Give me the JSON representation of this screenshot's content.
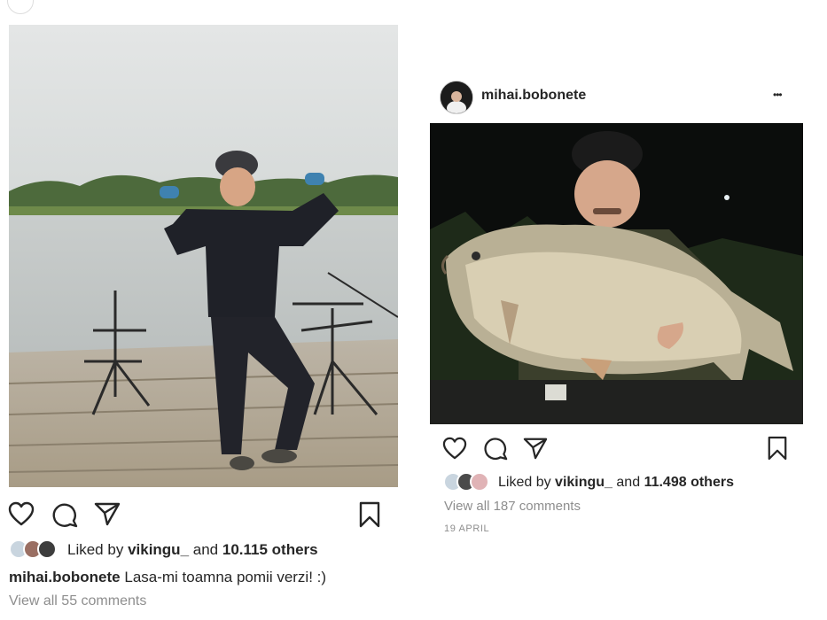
{
  "colors": {
    "text": "#262626",
    "muted": "#8e8e8e",
    "background": "#ffffff"
  },
  "post_left": {
    "likes": {
      "prefix": "Liked by",
      "user": "vikingu_",
      "middle": "and",
      "count": "10.115 others"
    },
    "caption": {
      "username": "mihai.bobonete",
      "text": "Lasa-mi toamna pomii verzi! :)"
    },
    "comments_link": "View all 55 comments",
    "icons": [
      "heart-icon",
      "comment-icon",
      "share-icon",
      "bookmark-icon"
    ]
  },
  "post_right": {
    "username": "mihai.bobonete",
    "more": "•••",
    "likes": {
      "prefix": "Liked by",
      "user": "vikingu_",
      "middle": "and",
      "count": "11.498 others"
    },
    "comments_link": "View all 187 comments",
    "date": "19 APRIL",
    "icons": [
      "heart-icon",
      "comment-icon",
      "share-icon",
      "bookmark-icon"
    ]
  }
}
